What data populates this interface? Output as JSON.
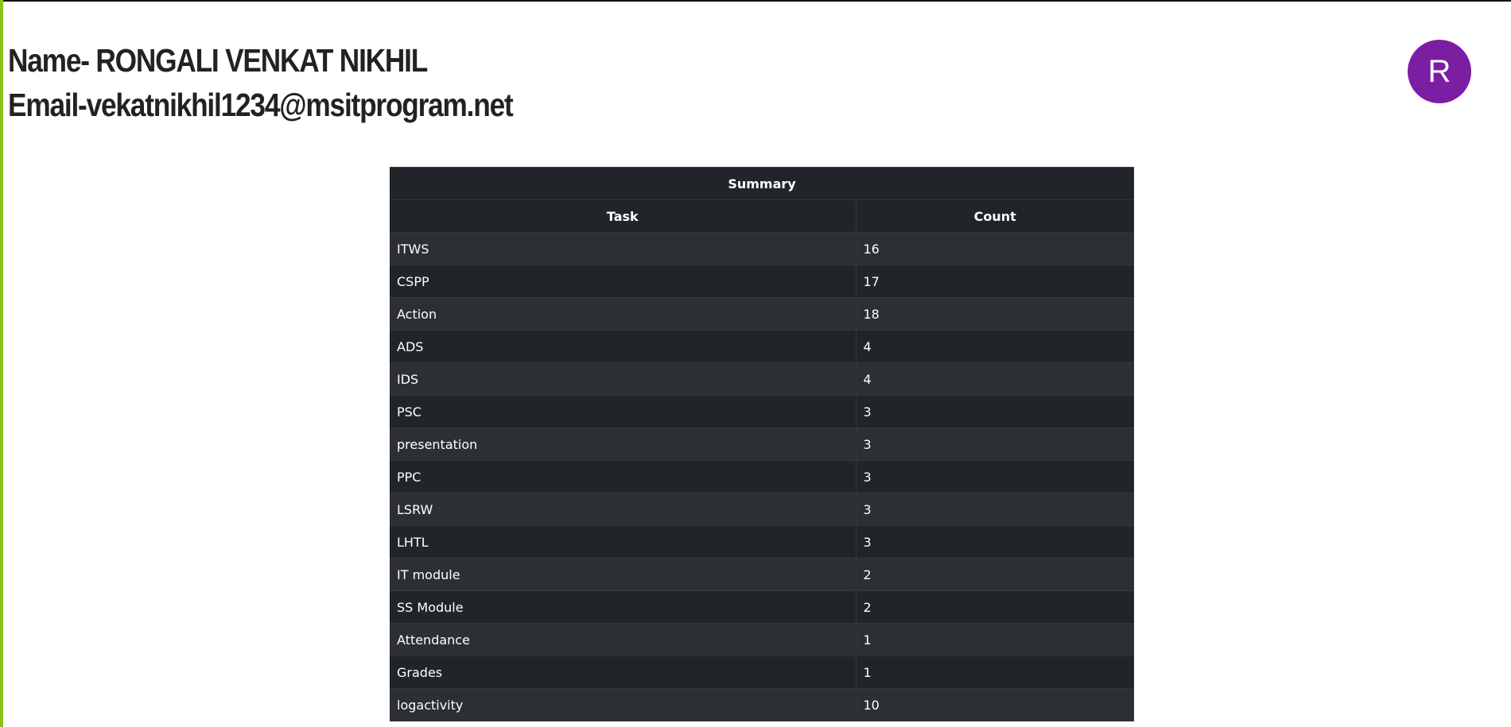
{
  "profile": {
    "name_line": "Name- RONGALI VENKAT NIKHIL",
    "email_line": "Email-vekatnikhil1234@msitprogram.net",
    "avatar_letter": "R",
    "avatar_color": "#7b1fa2"
  },
  "summary": {
    "title": "Summary",
    "columns": [
      "Task",
      "Count"
    ],
    "rows": [
      {
        "task": "ITWS",
        "count": "16"
      },
      {
        "task": "CSPP",
        "count": "17"
      },
      {
        "task": "Action",
        "count": "18"
      },
      {
        "task": "ADS",
        "count": "4"
      },
      {
        "task": "IDS",
        "count": "4"
      },
      {
        "task": "PSC",
        "count": "3"
      },
      {
        "task": "presentation",
        "count": "3"
      },
      {
        "task": "PPC",
        "count": "3"
      },
      {
        "task": "LSRW",
        "count": "3"
      },
      {
        "task": "LHTL",
        "count": "3"
      },
      {
        "task": "IT module",
        "count": "2"
      },
      {
        "task": "SS Module",
        "count": "2"
      },
      {
        "task": "Attendance",
        "count": "1"
      },
      {
        "task": "Grades",
        "count": "1"
      },
      {
        "task": "logactivity",
        "count": "10"
      }
    ]
  }
}
